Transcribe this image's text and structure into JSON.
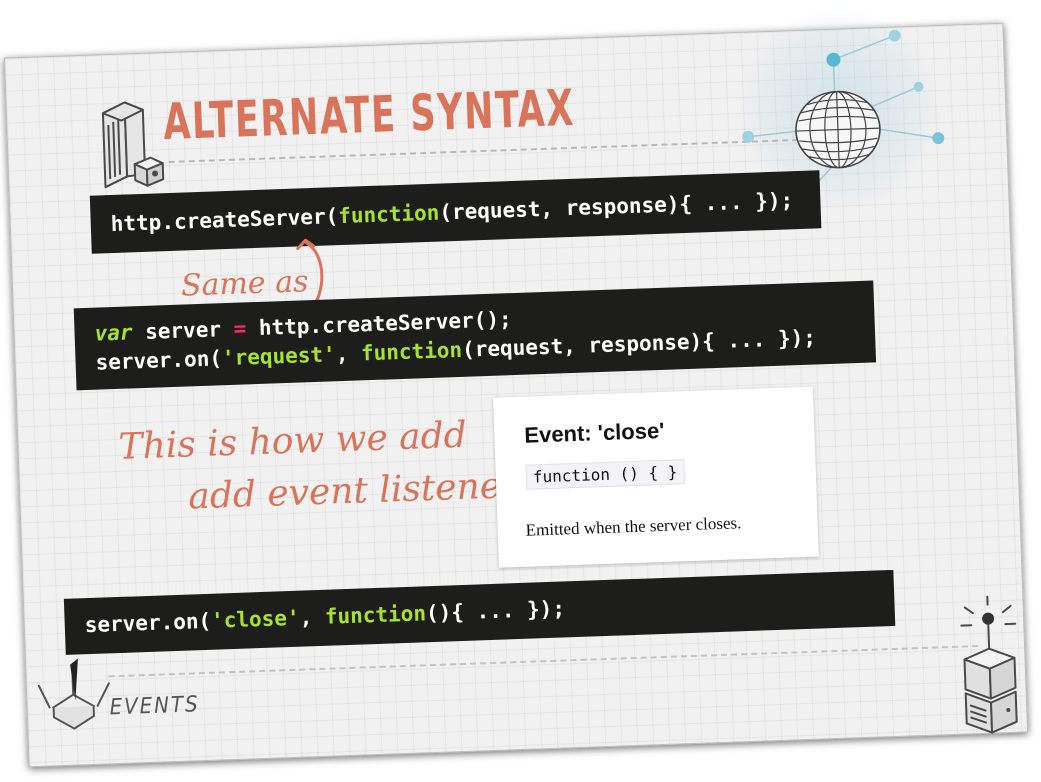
{
  "slide": {
    "title": "ALTERNATE SYNTAX",
    "footer_label": "EVENTS"
  },
  "code_blocks": [
    {
      "lines": [
        [
          {
            "t": "http.createServer(",
            "c": "plain"
          },
          {
            "t": "function",
            "c": "fn"
          },
          {
            "t": "(request, response){ ... });",
            "c": "plain"
          }
        ]
      ]
    },
    {
      "lines": [
        [
          {
            "t": "var",
            "c": "kw"
          },
          {
            "t": " server ",
            "c": "plain"
          },
          {
            "t": "=",
            "c": "op"
          },
          {
            "t": " http.createServer();",
            "c": "plain"
          }
        ],
        [
          {
            "t": "server.on(",
            "c": "plain"
          },
          {
            "t": "'request'",
            "c": "str"
          },
          {
            "t": ", ",
            "c": "plain"
          },
          {
            "t": "function",
            "c": "fn"
          },
          {
            "t": "(request, response){ ... });",
            "c": "plain"
          }
        ]
      ]
    },
    {
      "lines": [
        [
          {
            "t": "server.on(",
            "c": "plain"
          },
          {
            "t": "'close'",
            "c": "str"
          },
          {
            "t": ", ",
            "c": "plain"
          },
          {
            "t": "function",
            "c": "fn"
          },
          {
            "t": "(){ ... });",
            "c": "plain"
          }
        ]
      ]
    }
  ],
  "annotations": {
    "same_as": "Same as",
    "note_line1": "This is how we add",
    "note_line2": "add event listeners"
  },
  "doc_card": {
    "heading": "Event: 'close'",
    "signature": "function () { }",
    "description": "Emitted when the server closes."
  },
  "colors": {
    "accent": "#d9735a",
    "code_background": "#1d1e1c",
    "code_highlight": "#a7e22e",
    "code_operator": "#f92672",
    "globe_node": "#58b9d6"
  },
  "icons": [
    "server-rack-icon",
    "globe-network-icon",
    "satellite-dish-icon",
    "antenna-server-icon",
    "double-arrow-icon"
  ]
}
